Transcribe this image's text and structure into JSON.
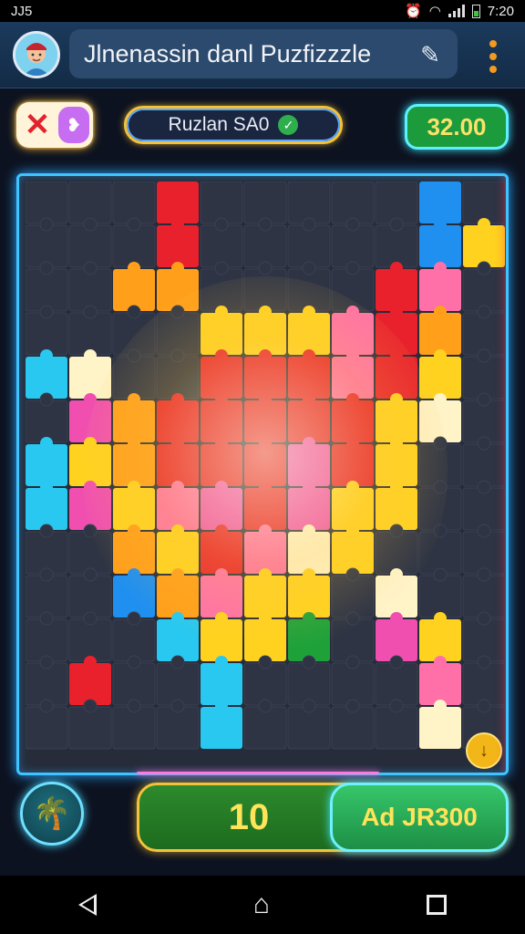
{
  "status_bar": {
    "time_left": "JJ5",
    "time_right": "7:20"
  },
  "header": {
    "title": "Jlnenassin danl Puzfizzzle"
  },
  "top": {
    "level_label": "Ruzlan SA0",
    "score": "32.00"
  },
  "bottom": {
    "moves": "10",
    "ad_label": "Ad JR300"
  },
  "colors": {
    "accent": "#3fc4ff",
    "gold": "#f3c23a",
    "green": "#1c9b3c"
  },
  "icons": [
    "avatar-icon",
    "edit-pen-icon",
    "more-vert-icon",
    "close-icon",
    "heart-icon",
    "check-icon",
    "coin-icon",
    "island-icon",
    "back-icon",
    "home-icon",
    "recent-apps-icon"
  ],
  "board": {
    "cols": 11,
    "rows": 13,
    "tiles": [
      [
        ".",
        ".",
        ".",
        "R",
        ".",
        ".",
        ".",
        ".",
        ".",
        "B",
        "."
      ],
      [
        ".",
        ".",
        ".",
        "R",
        ".",
        ".",
        ".",
        ".",
        ".",
        "B",
        "Y"
      ],
      [
        ".",
        ".",
        "O",
        "O",
        ".",
        ".",
        ".",
        ".",
        "R",
        "P",
        "."
      ],
      [
        ".",
        ".",
        ".",
        ".",
        "Y",
        "Y",
        "Y",
        "P",
        "R",
        "O",
        "."
      ],
      [
        "C",
        "W",
        ".",
        ".",
        "R",
        "R",
        "R",
        "P",
        "R",
        "Y",
        "."
      ],
      [
        ".",
        "M",
        "O",
        "R",
        "R",
        "R",
        "R",
        "R",
        "Y",
        "W",
        "."
      ],
      [
        "C",
        "Y",
        "O",
        "R",
        "R",
        "R",
        "M",
        "R",
        "Y",
        ".",
        "."
      ],
      [
        "C",
        "M",
        "Y",
        "P",
        "M",
        "R",
        "M",
        "Y",
        "Y",
        ".",
        "."
      ],
      [
        ".",
        ".",
        "O",
        "Y",
        "R",
        "P",
        "W",
        "Y",
        ".",
        ".",
        "."
      ],
      [
        ".",
        ".",
        "B",
        "O",
        "P",
        "Y",
        "Y",
        ".",
        "W",
        ".",
        "."
      ],
      [
        ".",
        ".",
        ".",
        "C",
        "Y",
        "Y",
        "G",
        ".",
        "M",
        "Y",
        "."
      ],
      [
        ".",
        "R",
        ".",
        ".",
        "C",
        ".",
        ".",
        ".",
        ".",
        "P",
        "."
      ],
      [
        ".",
        ".",
        ".",
        ".",
        "C",
        ".",
        ".",
        ".",
        ".",
        "W",
        "."
      ]
    ],
    "palette": {
      ".": "#2e3444",
      "R": "#e8212d",
      "O": "#ff9f1a",
      "Y": "#ffd21f",
      "B": "#1f8ff0",
      "C": "#28c8f0",
      "M": "#f04fb0",
      "P": "#ff6fa8",
      "G": "#1fa13a",
      "W": "#fff3c8"
    }
  }
}
